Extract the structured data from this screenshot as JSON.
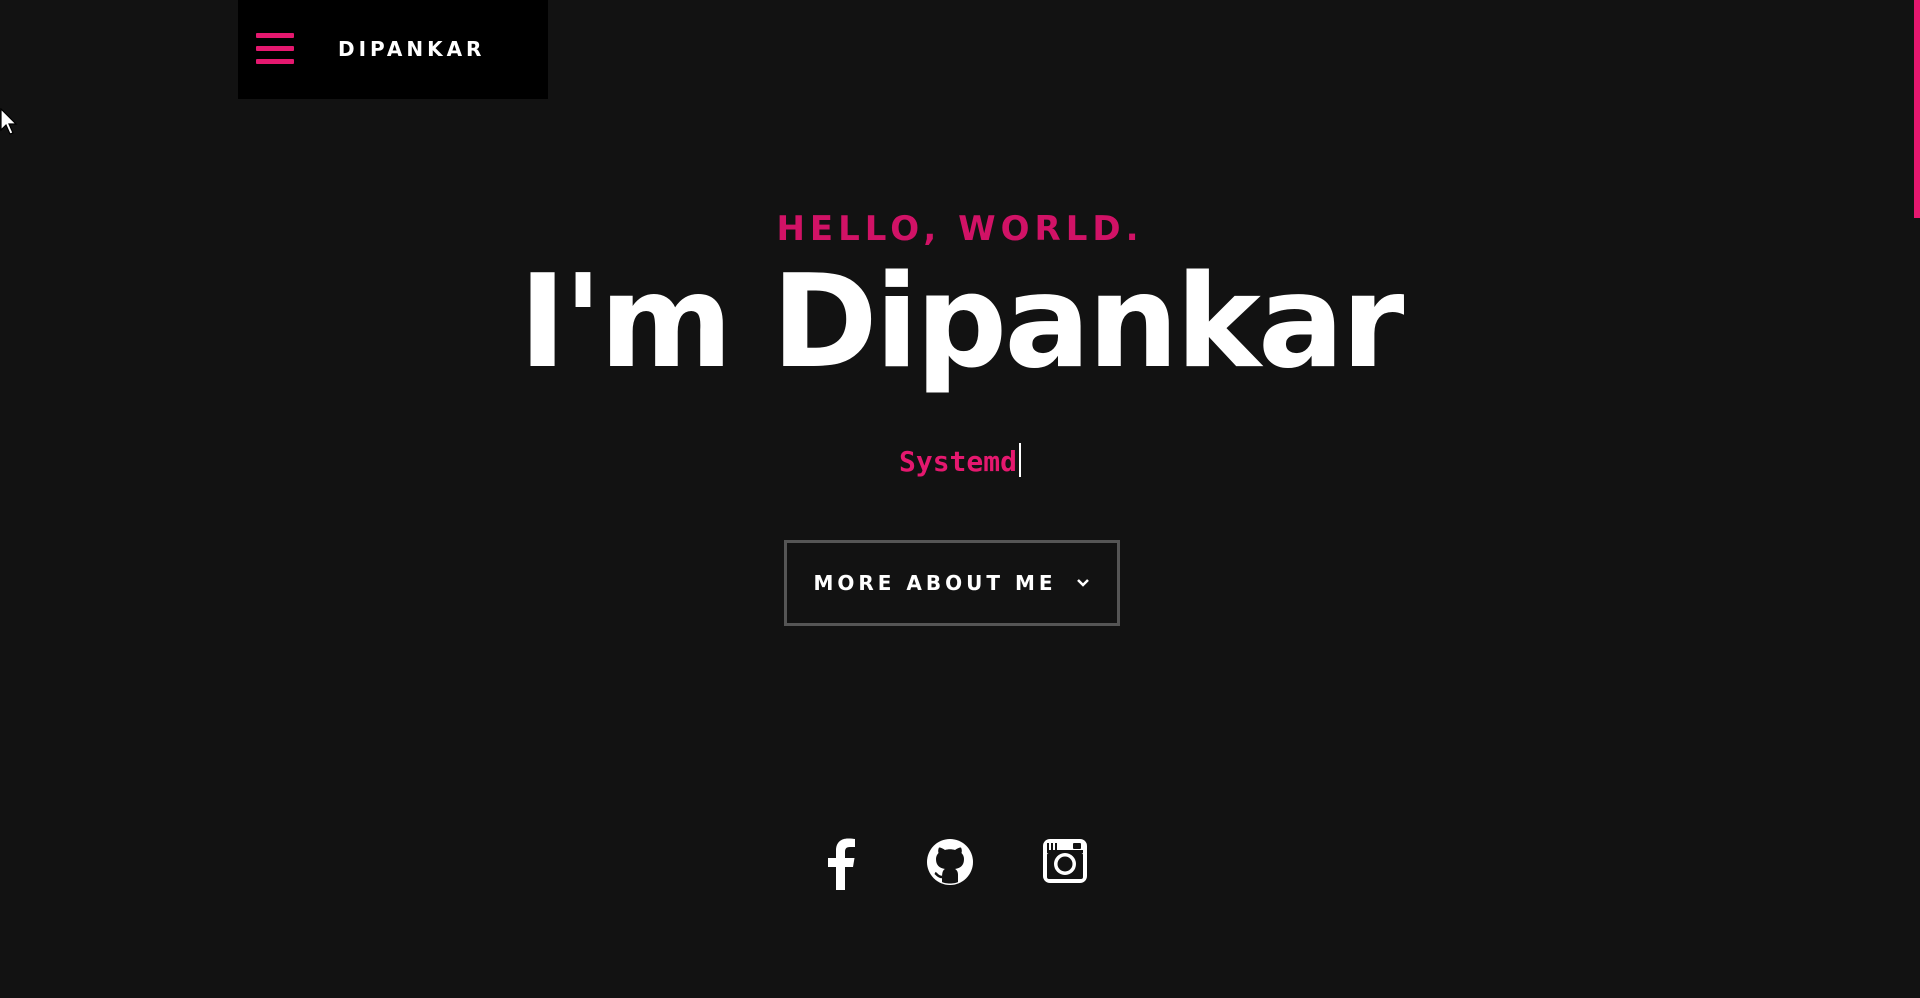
{
  "header": {
    "logo": "DIPANKAR",
    "menu_icon": "hamburger-menu-icon"
  },
  "hero": {
    "greeting": "HELLO, WORLD.",
    "headline": "I'm Dipankar",
    "typed_text": "Systemd",
    "cta_label": "MORE ABOUT ME"
  },
  "social": {
    "icons": [
      "facebook-icon",
      "github-icon",
      "instagram-icon"
    ]
  },
  "colors": {
    "background": "#121212",
    "header_bg": "#000000",
    "accent": "#e5186f",
    "greeting": "#d11266",
    "text": "#ffffff",
    "button_border": "#555555"
  }
}
